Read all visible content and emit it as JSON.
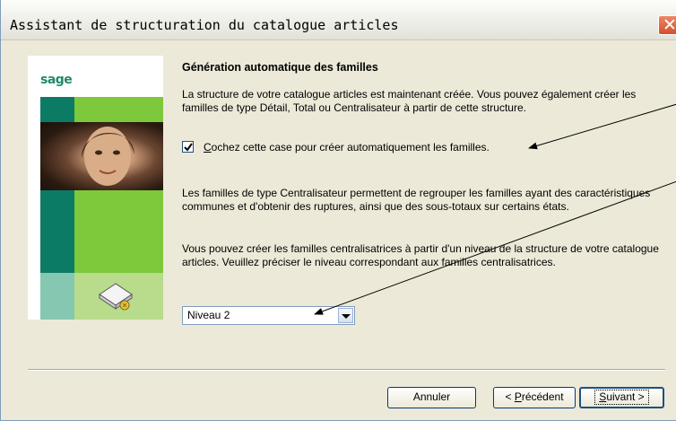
{
  "window": {
    "title": "Assistant de structuration du catalogue articles",
    "close_glyph": "✕"
  },
  "sidebar": {
    "logo_text": "sage"
  },
  "content": {
    "heading": "Génération automatique des familles",
    "para1": "La structure de votre catalogue articles est maintenant créée. Vous pouvez également créer les familles de type Détail, Total ou Centralisateur à partir de cette structure.",
    "checkbox": {
      "checked": true,
      "label_accel": "C",
      "label_rest": "ochez cette case pour créer automatiquement les familles."
    },
    "para2": "Les familles de type Centralisateur permettent de regrouper les familles ayant des caractéristiques communes et d'obtenir des ruptures, ainsi que des sous-totaux sur certains états.",
    "para3": "Vous pouvez créer les familles centralisatrices à partir d'un niveau de la structure de votre catalogue articles. Veuillez préciser le niveau correspondant aux familles centralisatrices.",
    "level_select": {
      "value": "Niveau 2"
    }
  },
  "buttons": {
    "cancel": "Annuler",
    "previous_prefix": "< ",
    "previous_accel": "P",
    "previous_rest": "récédent",
    "next_accel": "S",
    "next_rest": "uivant >"
  },
  "icons": [
    "close-icon",
    "book-icon",
    "check-icon",
    "chevron-down-icon",
    "arrow-annotation"
  ]
}
